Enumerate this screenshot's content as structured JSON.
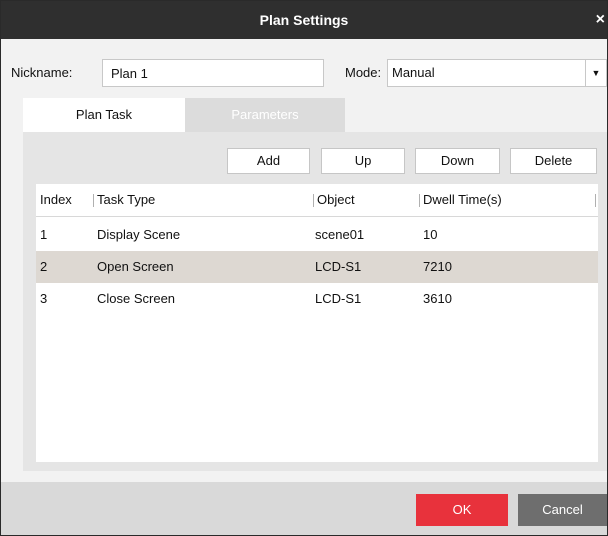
{
  "dialog": {
    "title": "Plan Settings",
    "close_glyph": "×"
  },
  "form": {
    "nickname_label": "Nickname:",
    "nickname_value": "Plan 1",
    "mode_label": "Mode:",
    "mode_value": "Manual"
  },
  "tabs": [
    {
      "label": "Plan Task",
      "active": true
    },
    {
      "label": "Parameters",
      "active": false
    }
  ],
  "toolbar": {
    "add": "Add",
    "up": "Up",
    "down": "Down",
    "delete": "Delete"
  },
  "table": {
    "columns": [
      "Index",
      "Task Type",
      "Object",
      "Dwell Time(s)"
    ],
    "rows": [
      {
        "index": "1",
        "task_type": "Display Scene",
        "object": "scene01",
        "dwell": "10",
        "selected": false
      },
      {
        "index": "2",
        "task_type": "Open Screen",
        "object": "LCD-S1",
        "dwell": "7210",
        "selected": true
      },
      {
        "index": "3",
        "task_type": "Close Screen",
        "object": "LCD-S1",
        "dwell": "3610",
        "selected": false
      }
    ]
  },
  "footer": {
    "ok": "OK",
    "cancel": "Cancel"
  },
  "colors": {
    "titlebar": "#2f2f2f",
    "ok_button": "#e8323c",
    "cancel_button": "#6e6e6e",
    "selected_row": "#ddd8d2"
  },
  "icons": {
    "close": "close-icon",
    "dropdown": "chevron-down-icon"
  }
}
